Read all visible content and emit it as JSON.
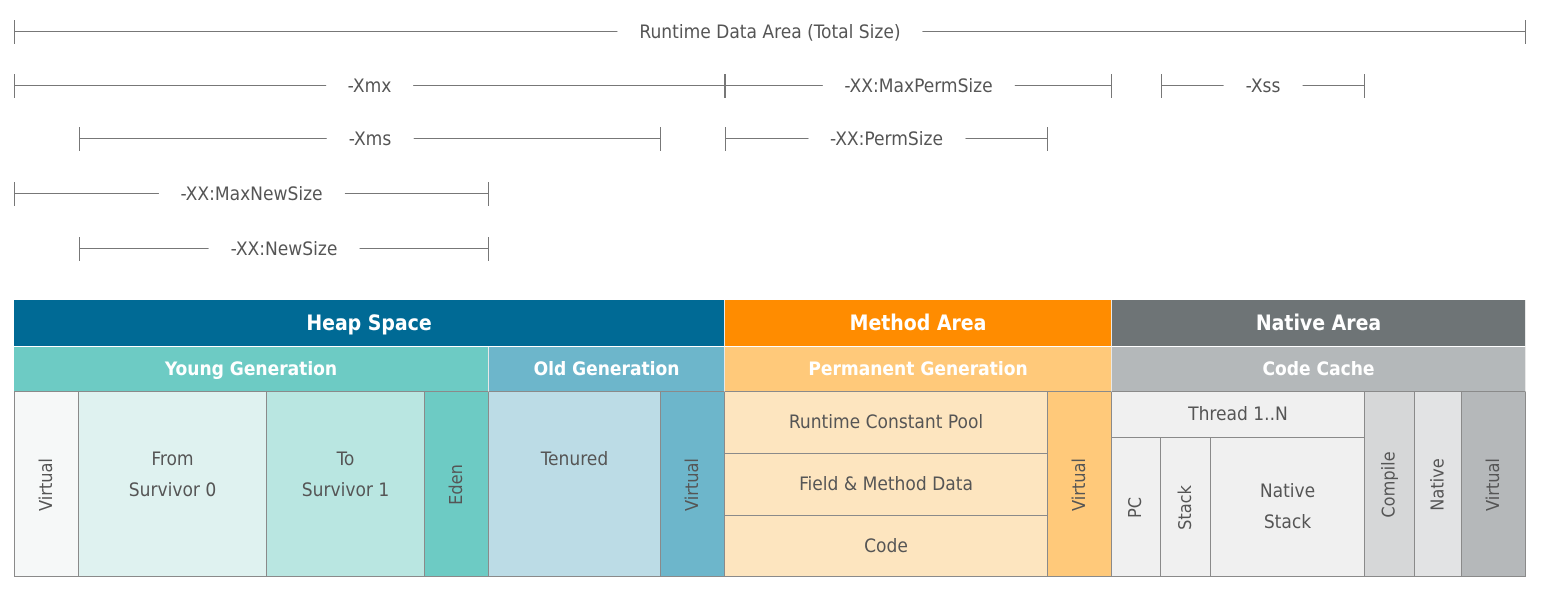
{
  "dimensions": {
    "total": "Runtime Data Area (Total Size)",
    "xmx": "-Xmx",
    "max_perm_size": "-XX:MaxPermSize",
    "xss": "-Xss",
    "xms": "-Xms",
    "perm_size": "-XX:PermSize",
    "max_new_size": "-XX:MaxNewSize",
    "new_size": "-XX:NewSize"
  },
  "heap": {
    "title": "Heap Space",
    "young": "Young Generation",
    "old": "Old Generation",
    "virtual": "Virtual",
    "from_survivor": [
      "From",
      "Survivor 0"
    ],
    "to_survivor": [
      "To",
      "Survivor 1"
    ],
    "eden": "Eden",
    "tenured": "Tenured",
    "old_virtual": "Virtual"
  },
  "method": {
    "title": "Method Area",
    "perm": "Permanent Generation",
    "runtime_constant_pool": "Runtime Constant Pool",
    "field_method_data": "Field & Method Data",
    "code": "Code",
    "virtual": "Virtual"
  },
  "native": {
    "title": "Native Area",
    "code_cache": "Code Cache",
    "thread": "Thread 1..N",
    "pc": "PC",
    "stack": "Stack",
    "native_stack": [
      "Native",
      "Stack"
    ],
    "compile": "Compile",
    "native": "Native",
    "virtual": "Virtual"
  },
  "colors": {
    "heap": "#006a95",
    "young": "#6dcbc4",
    "old": "#6db6cb",
    "method": "#ff8c00",
    "perm": "#ffc97a",
    "native": "#6e7476",
    "code_cache": "#b4b8ba"
  }
}
